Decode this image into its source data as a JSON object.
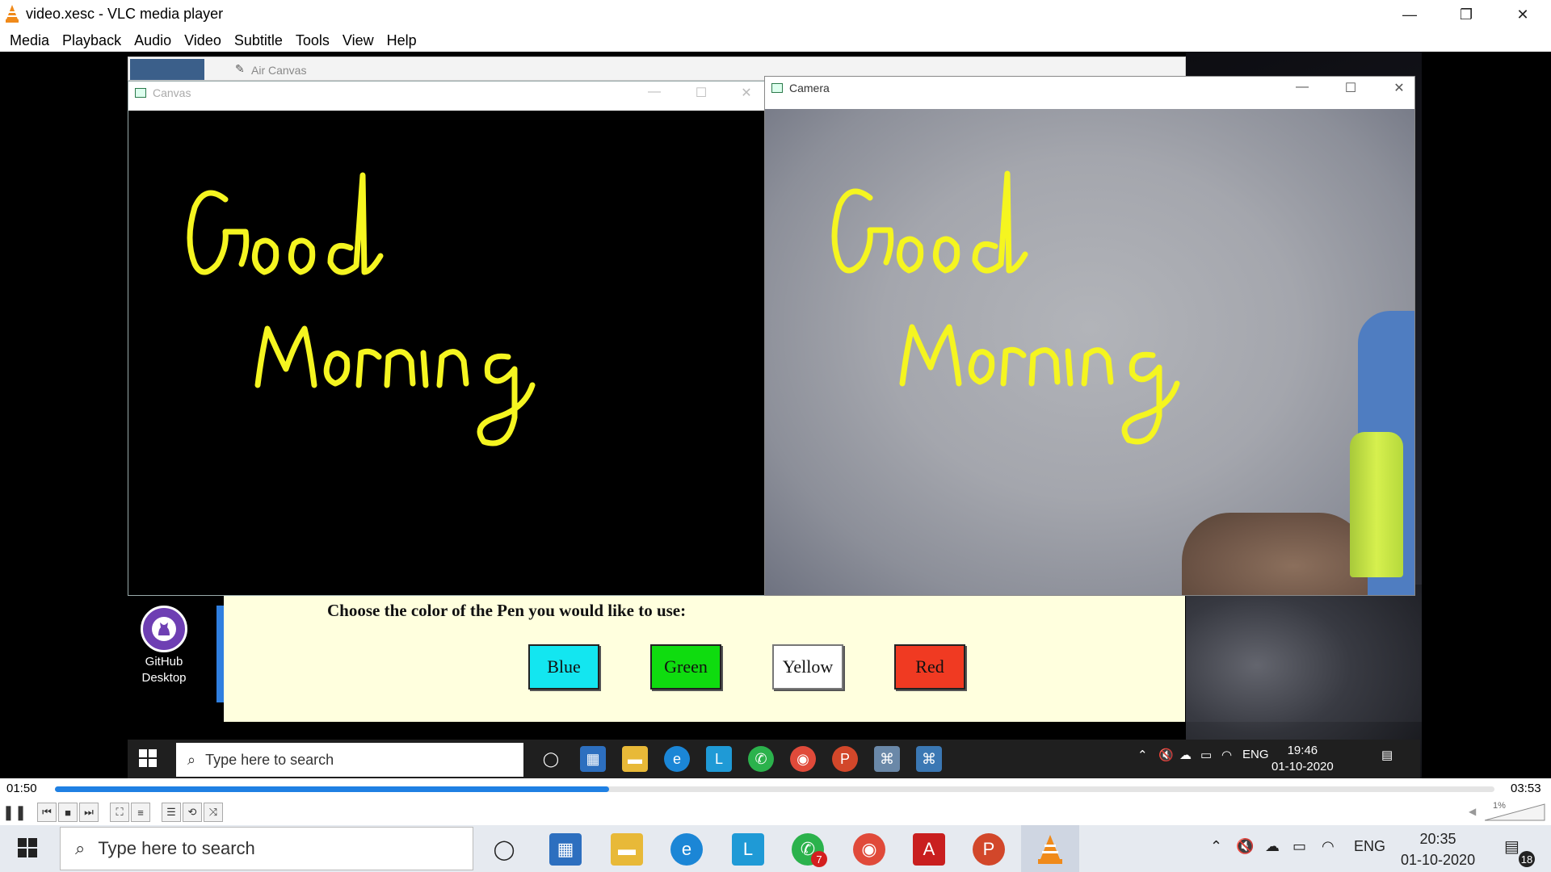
{
  "window": {
    "title": "video.xesc - VLC media player",
    "minimize": "—",
    "restore": "❐",
    "close": "✕"
  },
  "menu": [
    "Media",
    "Playback",
    "Audio",
    "Video",
    "Subtitle",
    "Tools",
    "View",
    "Help"
  ],
  "recording": {
    "air_canvas_title": "Air Canvas",
    "canvas_window_title": "Canvas",
    "camera_window_title": "Camera",
    "handwriting_line1": "Good",
    "handwriting_line2": "Morning",
    "ink_color": "#f5f520",
    "desktop_icon_label_line1": "GitHub",
    "desktop_icon_label_line2": "Desktop",
    "chooser_heading": "Choose the color of the Pen you would like to use:",
    "color_buttons": [
      {
        "label": "Blue",
        "color": "#13e6f0"
      },
      {
        "label": "Green",
        "color": "#0fdc0f"
      },
      {
        "label": "Yellow",
        "color": "#ffffff"
      },
      {
        "label": "Red",
        "color": "#f03a22"
      }
    ],
    "inner_taskbar": {
      "search_placeholder": "Type here to search",
      "language": "ENG",
      "time": "19:46",
      "date": "01-10-2020"
    }
  },
  "player": {
    "elapsed": "01:50",
    "total": "03:53",
    "progress_fraction": 0.385,
    "volume": "1%",
    "accent": "#1f80e3"
  },
  "taskbar": {
    "search_placeholder": "Type here to search",
    "language": "ENG",
    "time": "20:35",
    "date": "01-10-2020",
    "whatsapp_badge": "7",
    "notification_count": "18"
  }
}
